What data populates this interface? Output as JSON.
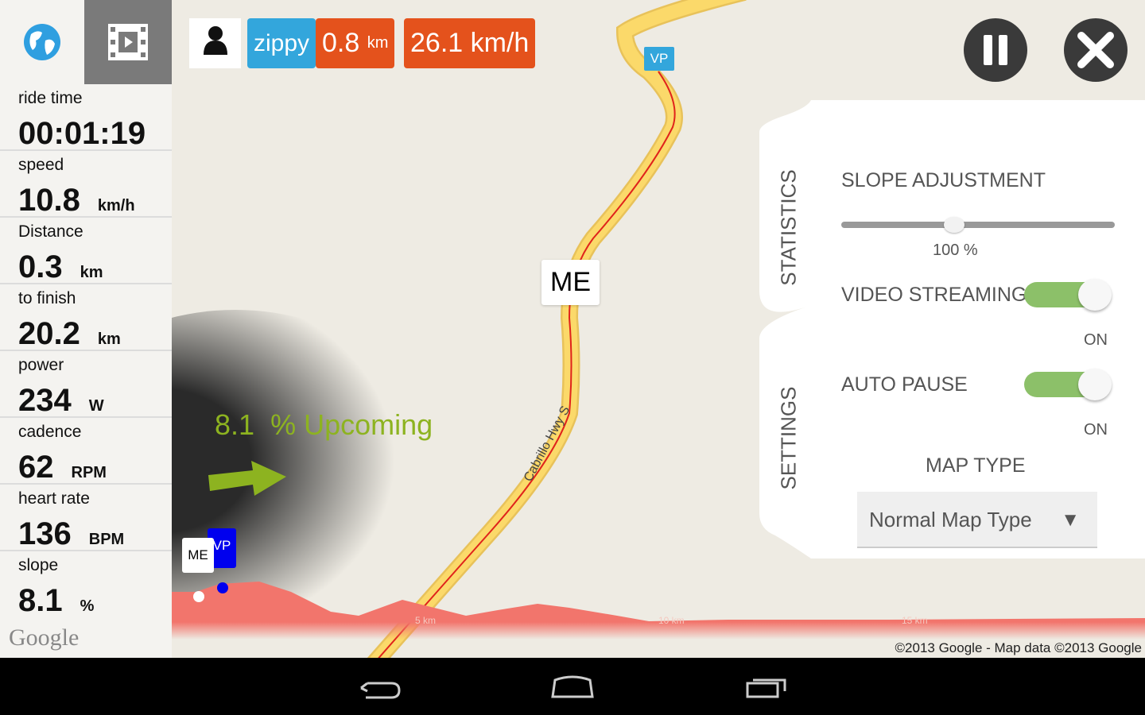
{
  "sidebar": {
    "tabs": [
      {
        "icon": "globe-icon"
      },
      {
        "icon": "film-icon"
      }
    ],
    "stats": [
      {
        "label": "ride time",
        "value": "00:01:19",
        "unit": ""
      },
      {
        "label": "speed",
        "value": "10.8",
        "unit": "km/h"
      },
      {
        "label": "Distance",
        "value": "0.3",
        "unit": "km"
      },
      {
        "label": "to finish",
        "value": "20.2",
        "unit": "km"
      },
      {
        "label": "power",
        "value": "234",
        "unit": "W"
      },
      {
        "label": "cadence",
        "value": "62",
        "unit": "RPM"
      },
      {
        "label": "heart rate",
        "value": "136",
        "unit": "BPM"
      },
      {
        "label": "slope",
        "value": "8.1",
        "unit": "%"
      }
    ],
    "google_logo": "Google"
  },
  "header": {
    "user": "zippy",
    "distance": "0.8",
    "distance_unit": "km",
    "speed": "26.1 km/h"
  },
  "map": {
    "marker_vp": "VP",
    "marker_me": "ME",
    "road_name": "Cabrillo Hwy S",
    "upcoming_value": "8.1",
    "upcoming_label": "% Upcoming",
    "profile_marks": [
      "5 km",
      "10 km",
      "15 km"
    ],
    "copyright": "©2013 Google - Map data ©2013 Google",
    "profile_me": "ME",
    "profile_vp": "VP"
  },
  "panel": {
    "tabs": [
      "STATISTICS",
      "SETTINGS"
    ],
    "slope_title": "SLOPE ADJUSTMENT",
    "slope_value": "100 %",
    "slope_fraction": 0.41,
    "video_streaming": "VIDEO STREAMING",
    "video_state": "ON",
    "auto_pause": "AUTO PAUSE",
    "auto_state": "ON",
    "map_type_title": "MAP TYPE",
    "map_type_value": "Normal Map Type"
  },
  "colors": {
    "blue": "#33a6dc",
    "orange": "#e4521c",
    "green": "#8cc069",
    "upcoming": "#8db320"
  }
}
